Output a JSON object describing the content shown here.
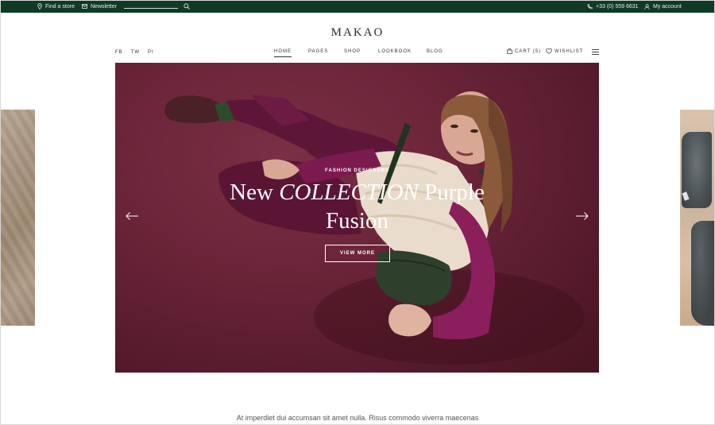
{
  "topbar": {
    "store_label": "Find a store",
    "newsletter_label": "Newsletter",
    "search_placeholder": "",
    "phone": "+33 (0) 559 6631",
    "account_label": "My account",
    "background_color": "#0f3a26"
  },
  "header": {
    "logo": "MAKAO",
    "social": [
      "FB",
      "TW",
      "PI"
    ],
    "nav": [
      "HOME",
      "PAGES",
      "SHOP",
      "LOOKBOOK",
      "BLOG"
    ],
    "active_nav": "HOME",
    "cart_label": "CART (5)",
    "wishlist_label": "WISHLIST"
  },
  "hero": {
    "eyebrow": "FASHION DESIGNERS",
    "headline_part1": "New ",
    "headline_italic": "COLLECTION",
    "headline_part2": " Purple",
    "headline_line2": "Fusion",
    "cta_label": "VIEW MORE",
    "accent_color": "#6a2438"
  },
  "footer_text": "At imperdiet dui accumsan sit amet nulla. Risus commodo viverra maecenas"
}
